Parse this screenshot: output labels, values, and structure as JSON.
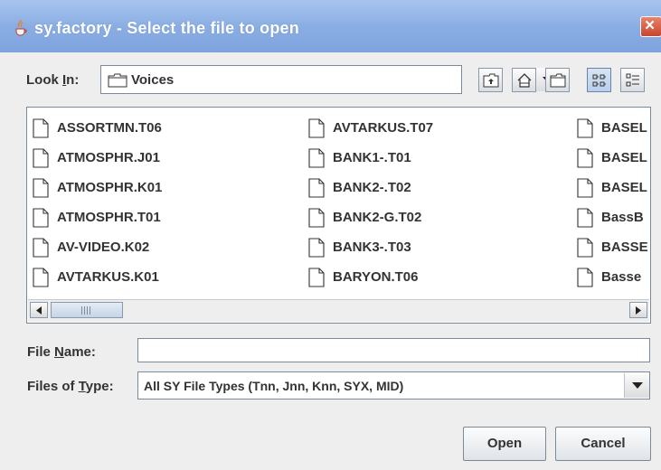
{
  "window": {
    "title": "sy.factory - Select the file to open",
    "close_label": "×"
  },
  "lookin": {
    "label_prefix": "Look ",
    "label_mnemonic": "I",
    "label_suffix": "n:",
    "value": "Voices"
  },
  "files": {
    "column1": [
      "ASSORTMN.T06",
      "ATMOSPHR.J01",
      "ATMOSPHR.K01",
      "ATMOSPHR.T01",
      "AV-VIDEO.K02",
      "AVTARKUS.K01"
    ],
    "column2": [
      "AVTARKUS.T07",
      "BANK1-.T01",
      "BANK2-.T02",
      "BANK2-G.T02",
      "BANK3-.T03",
      "BARYON.T06"
    ],
    "column3": [
      "BASEL",
      "BASEL",
      "BASEL",
      "BassB",
      "BASSE",
      "Basse"
    ]
  },
  "filename": {
    "label_prefix": "File ",
    "label_mnemonic": "N",
    "label_suffix": "ame:",
    "value": ""
  },
  "filetype": {
    "label_prefix": "Files of ",
    "label_mnemonic": "T",
    "label_suffix": "ype:",
    "value": "All SY File Types (Tnn, Jnn, Knn, SYX, MID)"
  },
  "buttons": {
    "open": "Open",
    "cancel": "Cancel"
  },
  "colors": {
    "titlebar": "#8aaee3",
    "close": "#c8452d",
    "background": "#eeeeee"
  }
}
